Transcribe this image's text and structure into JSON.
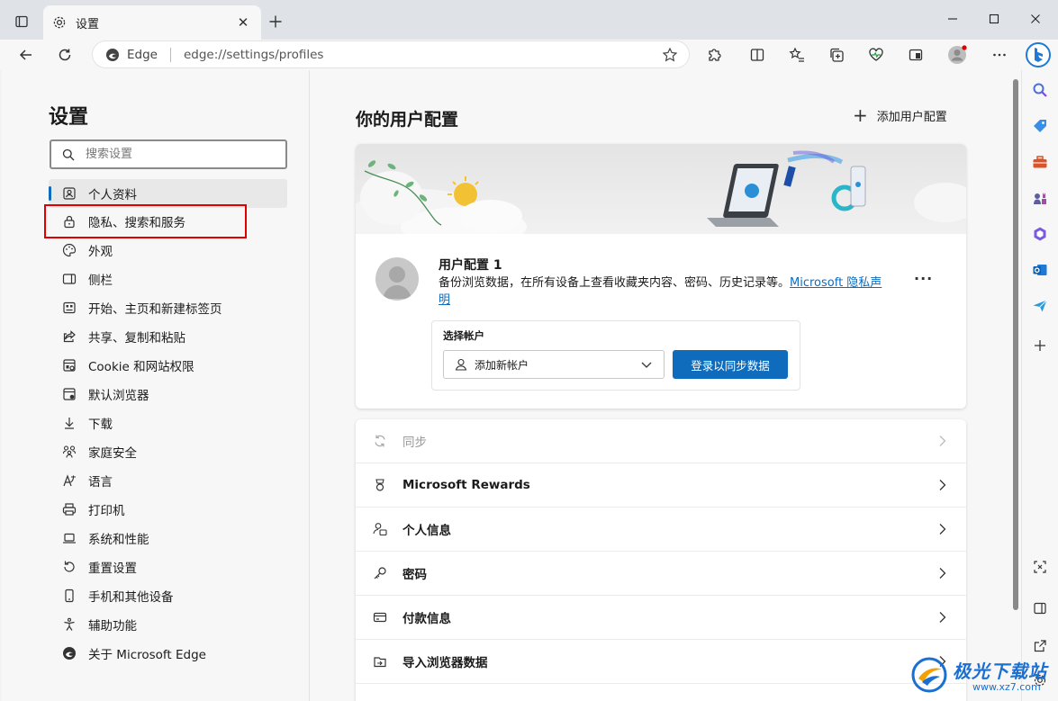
{
  "tab": {
    "title": "设置",
    "close_label": "✕"
  },
  "address": {
    "site": "Edge",
    "url": "edge://settings/profiles"
  },
  "left_nav": {
    "title": "设置",
    "search_placeholder": "搜索设置",
    "items": [
      {
        "label": "个人资料",
        "icon": "profile-icon"
      },
      {
        "label": "隐私、搜索和服务",
        "icon": "lock-icon"
      },
      {
        "label": "外观",
        "icon": "palette-icon"
      },
      {
        "label": "侧栏",
        "icon": "sidebar-icon"
      },
      {
        "label": "开始、主页和新建标签页",
        "icon": "home-icon"
      },
      {
        "label": "共享、复制和粘贴",
        "icon": "share-icon"
      },
      {
        "label": "Cookie 和网站权限",
        "icon": "site-permissions-icon"
      },
      {
        "label": "默认浏览器",
        "icon": "browser-icon"
      },
      {
        "label": "下载",
        "icon": "download-icon"
      },
      {
        "label": "家庭安全",
        "icon": "family-icon"
      },
      {
        "label": "语言",
        "icon": "language-icon"
      },
      {
        "label": "打印机",
        "icon": "printer-icon"
      },
      {
        "label": "系统和性能",
        "icon": "laptop-icon"
      },
      {
        "label": "重置设置",
        "icon": "reset-icon"
      },
      {
        "label": "手机和其他设备",
        "icon": "phone-icon"
      },
      {
        "label": "辅助功能",
        "icon": "accessibility-icon"
      },
      {
        "label": "关于 Microsoft Edge",
        "icon": "edge-logo-icon"
      }
    ]
  },
  "main": {
    "title": "你的用户配置",
    "add_profile": "添加用户配置",
    "profile": {
      "name": "用户配置 1",
      "desc": "备份浏览数据，在所有设备上查看收藏夹内容、密码、历史记录等。",
      "link": "Microsoft 隐私声明",
      "more": "···",
      "account_label": "选择帐户",
      "account_select": "添加新帐户",
      "signin_button": "登录以同步数据"
    },
    "rows": [
      {
        "label": "同步",
        "icon": "sync-icon",
        "disabled": true
      },
      {
        "label": "Microsoft Rewards",
        "icon": "rewards-icon"
      },
      {
        "label": "个人信息",
        "icon": "personal-info-icon"
      },
      {
        "label": "密码",
        "icon": "key-icon"
      },
      {
        "label": "付款信息",
        "icon": "card-icon"
      },
      {
        "label": "导入浏览器数据",
        "icon": "import-icon"
      }
    ]
  },
  "watermark": {
    "text": "极光下载站",
    "url": "www.xz7.com"
  },
  "colors": {
    "accent": "#0f6cbd",
    "highlight_box": "#e00000"
  }
}
